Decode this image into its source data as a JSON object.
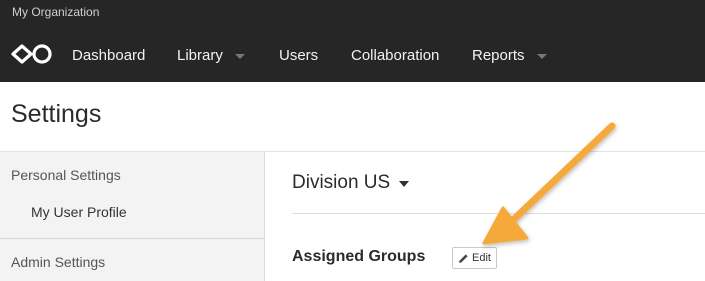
{
  "header": {
    "org_name": "My Organization",
    "logo_icon": "infinity-logo-icon",
    "nav": [
      {
        "label": "Dashboard",
        "dropdown": false
      },
      {
        "label": "Library",
        "dropdown": true
      },
      {
        "label": "Users",
        "dropdown": false
      },
      {
        "label": "Collaboration",
        "dropdown": false
      },
      {
        "label": "Reports",
        "dropdown": true
      }
    ]
  },
  "page": {
    "title": "Settings"
  },
  "sidebar": {
    "sections": [
      {
        "label": "Personal Settings",
        "items": [
          {
            "label": "My User Profile"
          }
        ]
      },
      {
        "label": "Admin Settings",
        "items": []
      }
    ]
  },
  "main": {
    "division_selector": "Division US",
    "assigned_groups_label": "Assigned Groups",
    "edit_button_label": "Edit",
    "edit_icon": "pencil-icon"
  },
  "colors": {
    "topbar_bg": "#262626",
    "annotation_arrow": "#f5a93a"
  }
}
